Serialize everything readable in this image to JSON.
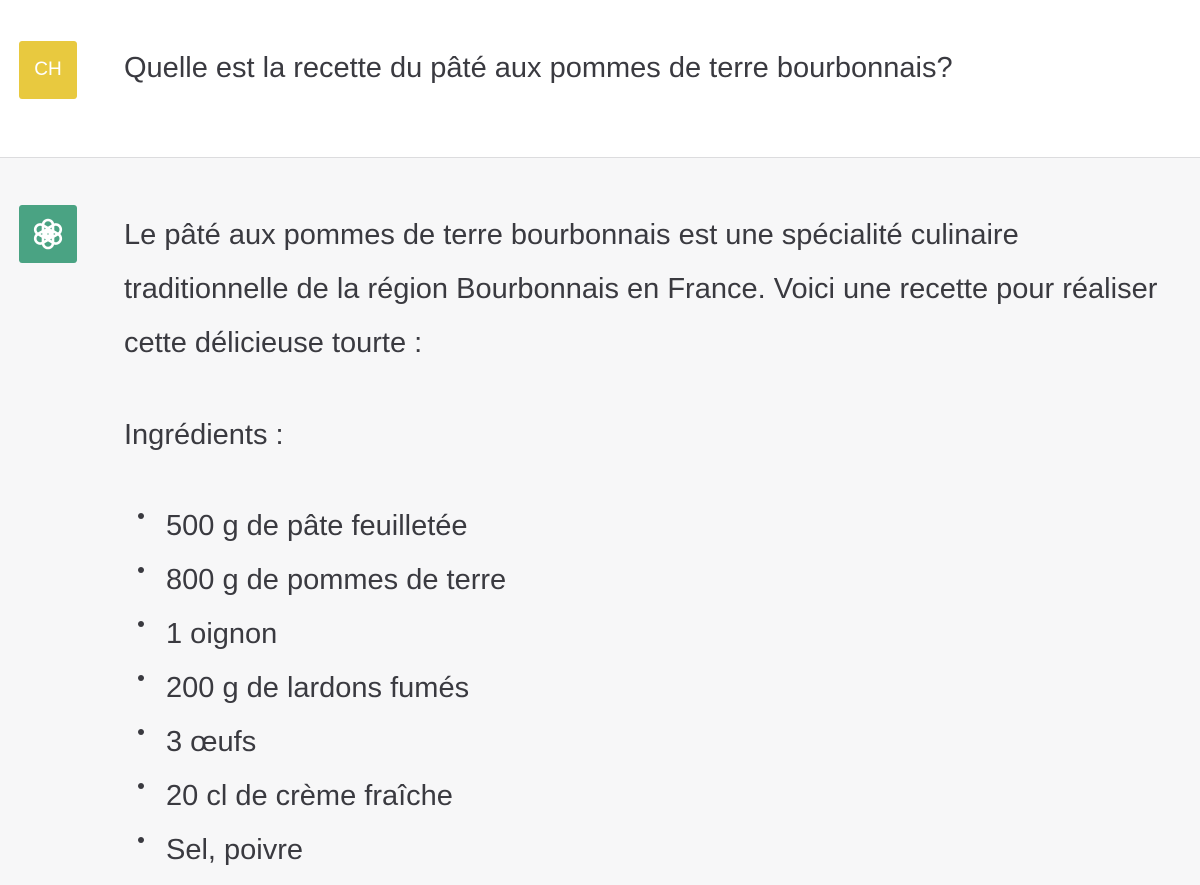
{
  "conversation": {
    "user": {
      "avatar_initials": "CH",
      "avatar_color": "#e8c93f",
      "message": "Quelle est la recette du pâté aux pommes de terre bourbonnais?"
    },
    "assistant": {
      "avatar_icon": "openai-logo-icon",
      "avatar_color": "#4aa383",
      "intro": "Le pâté aux pommes de terre bourbonnais est une spécialité culinaire traditionnelle de la région Bourbonnais en France. Voici une recette pour réaliser cette délicieuse tourte :",
      "ingredients_heading": "Ingrédients :",
      "ingredients": [
        "500 g de pâte feuilletée",
        "800 g de pommes de terre",
        "1 oignon",
        "200 g de lardons fumés",
        "3 œufs",
        "20 cl de crème fraîche",
        "Sel, poivre"
      ]
    }
  }
}
